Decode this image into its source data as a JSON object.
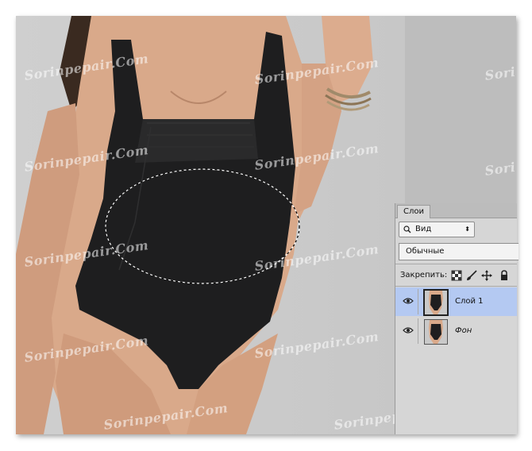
{
  "watermark_text": "Sorinpepair.Com",
  "layers_panel": {
    "tab_label": "Слои",
    "filter": {
      "label": "Вид",
      "icon": "search-icon"
    },
    "blend_mode": "Обычные",
    "lock_label": "Закрепить:",
    "lock_icons": [
      "lock-transparent-icon",
      "brush-icon",
      "move-icon",
      "lock-icon"
    ],
    "layers": [
      {
        "name": "Слой 1",
        "visible": true,
        "selected": true
      },
      {
        "name": "Фон",
        "visible": true,
        "selected": false
      }
    ]
  },
  "colors": {
    "selection_highlight": "#b4c9f2",
    "panel_background": "#d6d6d6",
    "canvas_background": "#c9c9c9"
  }
}
